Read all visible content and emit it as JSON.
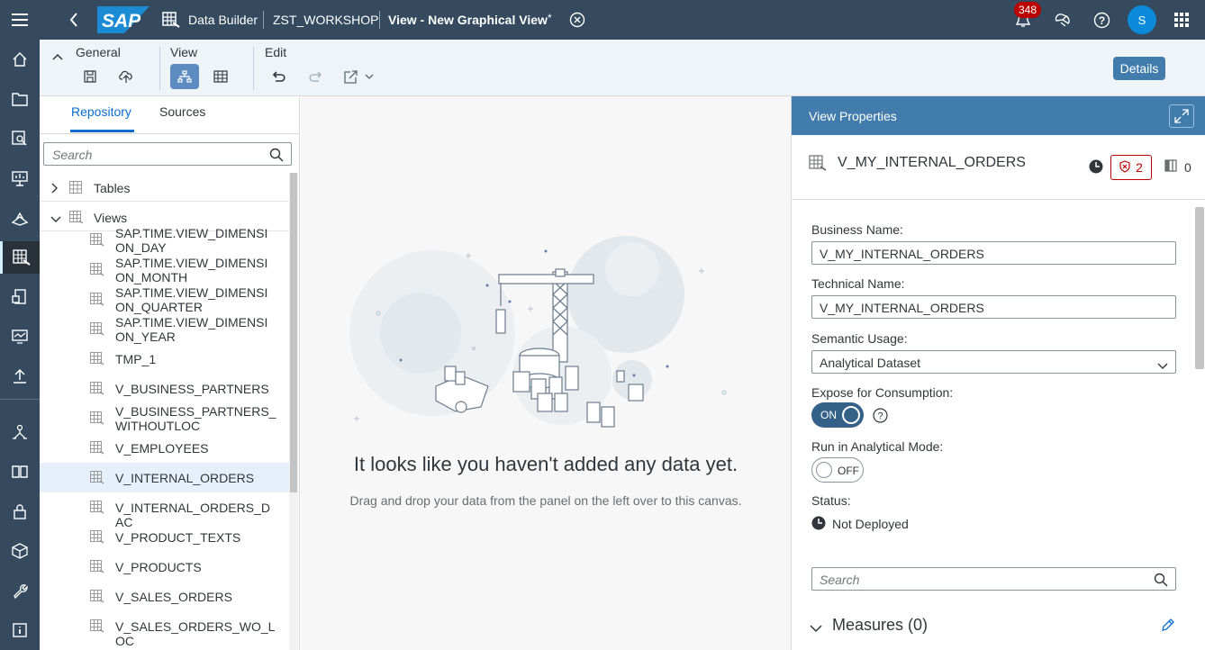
{
  "shell": {
    "product": "Data Builder",
    "space": "ZST_WORKSHOP",
    "tab_title": "View - New Graphical View",
    "tab_modified": "*",
    "notifications": "348",
    "user_initial": "S"
  },
  "toolbar": {
    "general": "General",
    "view": "View",
    "edit": "Edit",
    "details": "Details"
  },
  "left": {
    "tab_repository": "Repository",
    "tab_sources": "Sources",
    "search_placeholder": "Search",
    "cat_tables": "Tables",
    "cat_views": "Views",
    "views": [
      "SAP.TIME.VIEW_DIMENSION_DAY",
      "SAP.TIME.VIEW_DIMENSION_MONTH",
      "SAP.TIME.VIEW_DIMENSION_QUARTER",
      "SAP.TIME.VIEW_DIMENSION_YEAR",
      "TMP_1",
      "V_BUSINESS_PARTNERS",
      "V_BUSINESS_PARTNERS_WITHOUTLOC",
      "V_EMPLOYEES",
      "V_INTERNAL_ORDERS",
      "V_INTERNAL_ORDERS_DAC",
      "V_PRODUCT_TEXTS",
      "V_PRODUCTS",
      "V_SALES_ORDERS",
      "V_SALES_ORDERS_WO_LOC"
    ]
  },
  "canvas": {
    "headline": "It looks like you haven't added any data yet.",
    "hint": "Drag and drop your data from the panel on the left over to this canvas."
  },
  "props": {
    "title": "View Properties",
    "object_name": "V_MY_INTERNAL_ORDERS",
    "badge_count": "2",
    "columns_count": "0",
    "business_name_label": "Business Name:",
    "business_name": "V_MY_INTERNAL_ORDERS",
    "technical_name_label": "Technical Name:",
    "technical_name": "V_MY_INTERNAL_ORDERS",
    "semantic_usage_label": "Semantic Usage:",
    "semantic_usage": "Analytical Dataset",
    "expose_label": "Expose for Consumption:",
    "expose_value": "ON",
    "analytical_label": "Run in Analytical Mode:",
    "analytical_value": "OFF",
    "status_label": "Status:",
    "status_value": "Not Deployed",
    "search_placeholder": "Search",
    "measures": "Measures (0)"
  },
  "colors": {
    "shell": "#354a5f",
    "accent": "#427cac",
    "link": "#0a6ed1",
    "error": "#bb0000"
  }
}
